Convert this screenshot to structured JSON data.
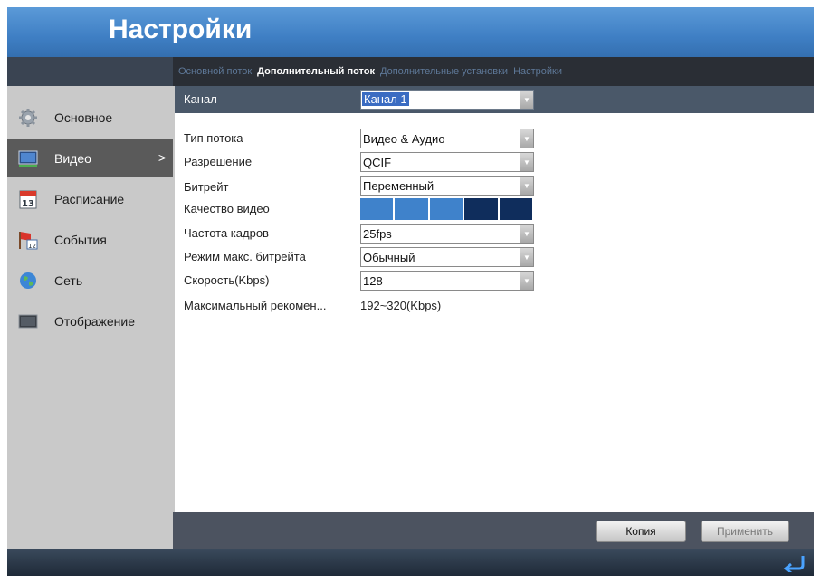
{
  "window": {
    "title": "Настройки"
  },
  "sidebar": {
    "items": [
      {
        "label": "Основное",
        "icon": "gear-icon"
      },
      {
        "label": "Видео",
        "icon": "monitor-icon",
        "active": true,
        "chevron": ">"
      },
      {
        "label": "Расписание",
        "icon": "calendar-icon",
        "icon_text": "13"
      },
      {
        "label": "События",
        "icon": "flag-calendar-icon",
        "icon_text": "12"
      },
      {
        "label": "Сеть",
        "icon": "globe-icon"
      },
      {
        "label": "Отображение",
        "icon": "display-icon"
      }
    ]
  },
  "tabs": [
    {
      "label": "Основной поток",
      "active": false
    },
    {
      "label": "Дополнительный поток",
      "active": true
    },
    {
      "label": "Дополнительные установки",
      "active": false
    },
    {
      "label": "Настройки",
      "active": false
    }
  ],
  "form": {
    "channel": {
      "label": "Канал",
      "value": "Канал 1"
    },
    "stream_type": {
      "label": "Тип потока",
      "value": "Видео & Аудио"
    },
    "resolution": {
      "label": "Разрешение",
      "value": "QCIF"
    },
    "bitrate": {
      "label": "Битрейт",
      "value": "Переменный"
    },
    "video_quality": {
      "label": "Качество видео",
      "level": 3,
      "max": 5
    },
    "frame_rate": {
      "label": "Частота кадров",
      "value": "25fps"
    },
    "max_bitrate_mode": {
      "label": "Режим макс. битрейта",
      "value": "Обычный"
    },
    "speed": {
      "label": "Скорость(Kbps)",
      "value": "128"
    },
    "max_recommended": {
      "label": "Максимальный рекомен...",
      "value": "192~320(Kbps)"
    }
  },
  "buttons": {
    "copy": "Копия",
    "apply": "Применить"
  },
  "colors": {
    "title_bar": "#4a8ad0",
    "quality_on": "#3f82cb",
    "quality_off": "#0f2d5c",
    "selection": "#3b6cc2"
  }
}
